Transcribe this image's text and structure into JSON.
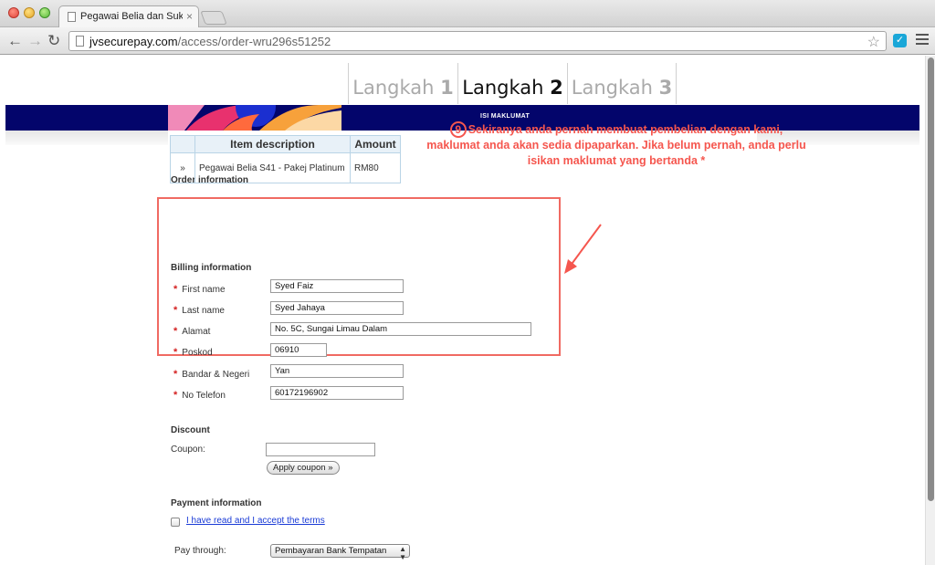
{
  "browser": {
    "tab_title": "Pegawai Belia dan Sukan -",
    "tab_close": "×",
    "url_host": "jvsecurepay.com",
    "url_path": "/access/order-wru296s51252"
  },
  "steps": [
    {
      "word": "Langkah",
      "num": "1",
      "active": false
    },
    {
      "word": "Langkah",
      "num": "2",
      "active": true
    },
    {
      "word": "Langkah",
      "num": "3",
      "active": false
    }
  ],
  "banner_label": "ISI MAKLUMAT",
  "order": {
    "title": "Order information",
    "col_description": "Item description",
    "col_amount": "Amount",
    "row_bullet": "»",
    "item_description": "Pegawai Belia S41 - Pakej Platinum",
    "item_amount": "RM80"
  },
  "billing": {
    "title": "Billing information",
    "required_mark": "*",
    "fields": [
      {
        "label": "First name",
        "value": "Syed Faiz"
      },
      {
        "label": "Last name",
        "value": "Syed Jahaya"
      },
      {
        "label": "Alamat",
        "value": "No. 5C, Sungai Limau Dalam"
      },
      {
        "label": "Poskod",
        "value": "06910"
      },
      {
        "label": "Bandar & Negeri",
        "value": "Yan"
      },
      {
        "label": "No Telefon",
        "value": "60172196902"
      }
    ]
  },
  "annotation": {
    "number": "9",
    "text": "Sekiranya anda pernah membuat pembelian dengan kami, maklumat anda akan sedia dipaparkan. Jika belum pernah, anda perlu isikan maklumat yang bertanda *"
  },
  "discount": {
    "title": "Discount",
    "coupon_label": "Coupon:",
    "coupon_value": "",
    "apply_label": "Apply coupon »"
  },
  "payment": {
    "title": "Payment information",
    "terms_label": "I have read and I accept the terms",
    "pay_through_label": "Pay through:",
    "pay_through_value": "Pembayaran Bank Tempatan"
  },
  "colors": {
    "banner": "#03056b",
    "annotation": "#f5564e",
    "required": "#d42020",
    "link": "#1a3bd6"
  }
}
